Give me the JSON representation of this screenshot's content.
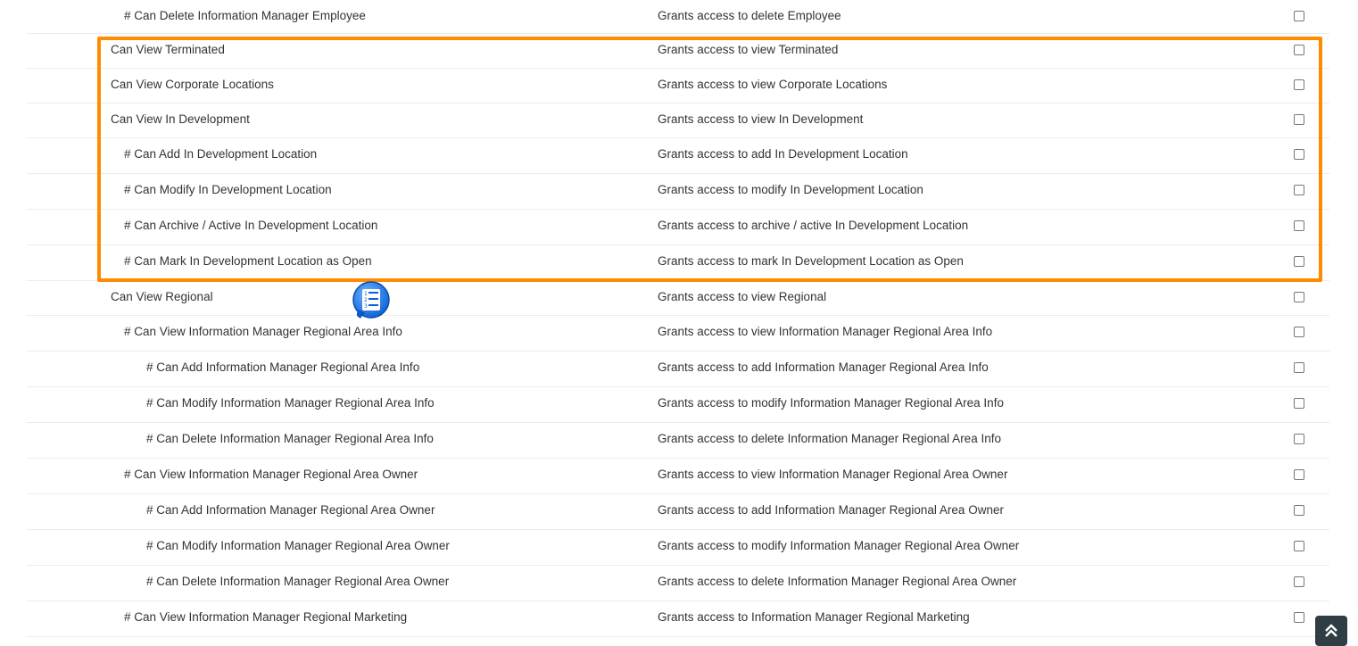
{
  "permissions": [
    {
      "name": "# Can Delete Information Manager Employee",
      "desc": "Grants access to delete Employee",
      "level": 1
    },
    {
      "name": "Can View Terminated",
      "desc": "Grants access to view Terminated",
      "level": 0
    },
    {
      "name": "Can View Corporate Locations",
      "desc": "Grants access to view Corporate Locations",
      "level": 0
    },
    {
      "name": "Can View In Development",
      "desc": "Grants access to view In Development",
      "level": 0
    },
    {
      "name": "# Can Add In Development Location",
      "desc": "Grants access to add In Development Location",
      "level": 1
    },
    {
      "name": "# Can Modify In Development Location",
      "desc": "Grants access to modify In Development Location",
      "level": 1
    },
    {
      "name": "# Can Archive / Active In Development Location",
      "desc": "Grants access to archive / active In Development Location",
      "level": 1
    },
    {
      "name": "# Can Mark In Development Location as Open",
      "desc": "Grants access to mark In Development Location as Open",
      "level": 1
    },
    {
      "name": "Can View Regional",
      "desc": "Grants access to view Regional",
      "level": 0
    },
    {
      "name": "# Can View Information Manager Regional Area Info",
      "desc": "Grants access to view Information Manager Regional Area Info",
      "level": 1
    },
    {
      "name": "# Can Add Information Manager Regional Area Info",
      "desc": "Grants access to add Information Manager Regional Area Info",
      "level": 2
    },
    {
      "name": "# Can Modify Information Manager Regional Area Info",
      "desc": "Grants access to modify Information Manager Regional Area Info",
      "level": 2
    },
    {
      "name": "# Can Delete Information Manager Regional Area Info",
      "desc": "Grants access to delete Information Manager Regional Area Info",
      "level": 2
    },
    {
      "name": "# Can View Information Manager Regional Area Owner",
      "desc": "Grants access to view Information Manager Regional Area Owner",
      "level": 1
    },
    {
      "name": "# Can Add Information Manager Regional Area Owner",
      "desc": "Grants access to add Information Manager Regional Area Owner",
      "level": 2
    },
    {
      "name": "# Can Modify Information Manager Regional Area Owner",
      "desc": "Grants access to modify Information Manager Regional Area Owner",
      "level": 2
    },
    {
      "name": "# Can Delete Information Manager Regional Area Owner",
      "desc": "Grants access to delete Information Manager Regional Area Owner",
      "level": 2
    },
    {
      "name": "# Can View Information Manager Regional Marketing",
      "desc": "Grants access to Information Manager Regional Marketing",
      "level": 1
    }
  ],
  "highlight_color": "#ff8c00",
  "icons": {
    "floating": "numbered-list-icon",
    "scroll": "double-chevron-up-icon"
  }
}
